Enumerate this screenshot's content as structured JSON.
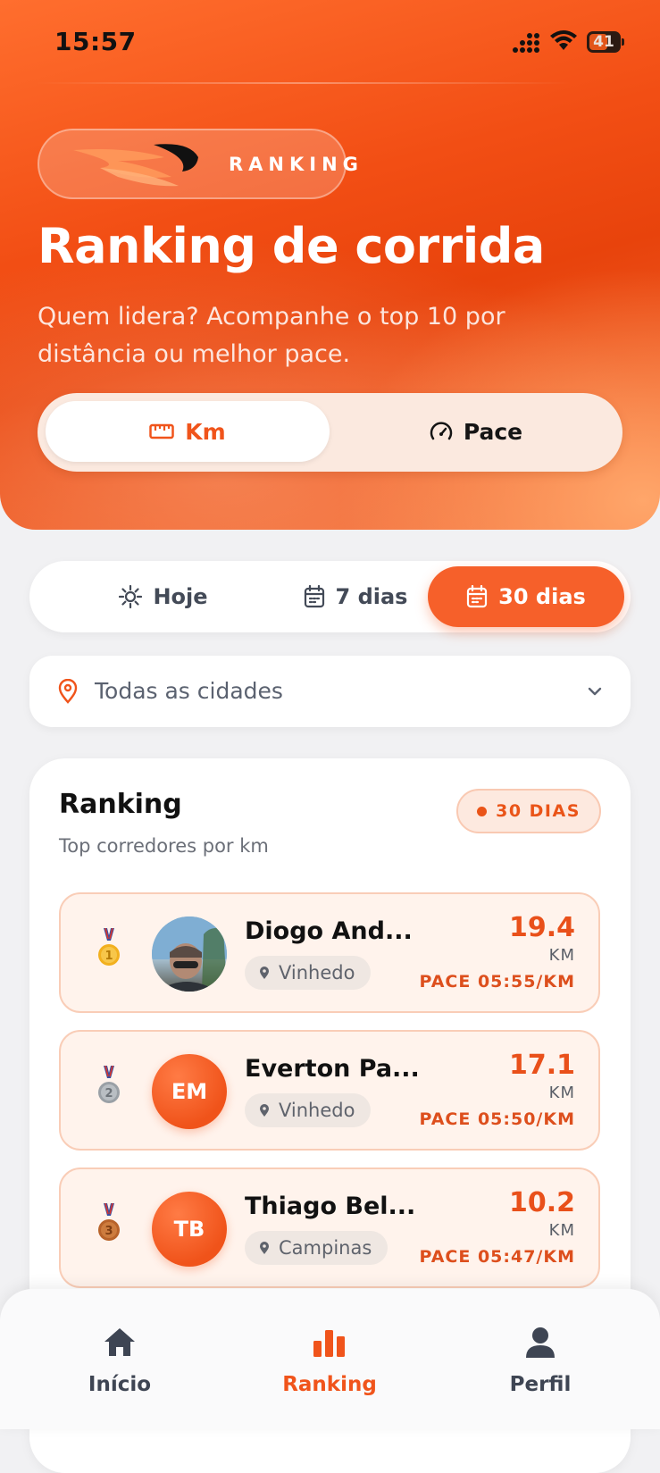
{
  "status_bar": {
    "time": "15:57",
    "battery": "41"
  },
  "header": {
    "badge_label": "RANKING",
    "title": "Ranking de corrida",
    "subtitle": "Quem lidera? Acompanhe o top 10 por distância ou melhor pace."
  },
  "metric_toggle": {
    "options": [
      {
        "label": "Km",
        "icon": "ruler-icon",
        "selected": true
      },
      {
        "label": "Pace",
        "icon": "speedometer-icon",
        "selected": false
      }
    ]
  },
  "period_filter": {
    "options": [
      {
        "label": "Hoje",
        "icon": "sun-icon",
        "selected": false
      },
      {
        "label": "7 dias",
        "icon": "calendar-icon",
        "selected": false
      },
      {
        "label": "30 dias",
        "icon": "calendar-icon",
        "selected": true
      }
    ]
  },
  "city_select": {
    "value": "Todas as cidades",
    "icon": "location-pin-icon"
  },
  "ranking": {
    "title": "Ranking",
    "subtitle": "Top corredores por km",
    "period_tag": "30 DIAS",
    "rows": [
      {
        "rank": 1,
        "medal": "gold",
        "name": "Diogo And...",
        "initials": "",
        "city": "Vinhedo",
        "value": "19.4",
        "unit": "KM",
        "pace": "PACE 05:55/KM"
      },
      {
        "rank": 2,
        "medal": "silver",
        "name": "Everton Pa...",
        "initials": "EM",
        "city": "Vinhedo",
        "value": "17.1",
        "unit": "KM",
        "pace": "PACE 05:50/KM"
      },
      {
        "rank": 3,
        "medal": "bronze",
        "name": "Thiago Bel...",
        "initials": "TB",
        "city": "Campinas",
        "value": "10.2",
        "unit": "KM",
        "pace": "PACE 05:47/KM"
      }
    ]
  },
  "bottom_nav": {
    "items": [
      {
        "label": "Início",
        "icon": "home-icon",
        "active": false
      },
      {
        "label": "Ranking",
        "icon": "bar-chart-icon",
        "active": true
      },
      {
        "label": "Perfil",
        "icon": "user-icon",
        "active": false
      }
    ]
  },
  "colors": {
    "accent": "#f0541b",
    "gold": "#f2b01e",
    "silver": "#9aa0a6",
    "bronze": "#b8632a"
  }
}
